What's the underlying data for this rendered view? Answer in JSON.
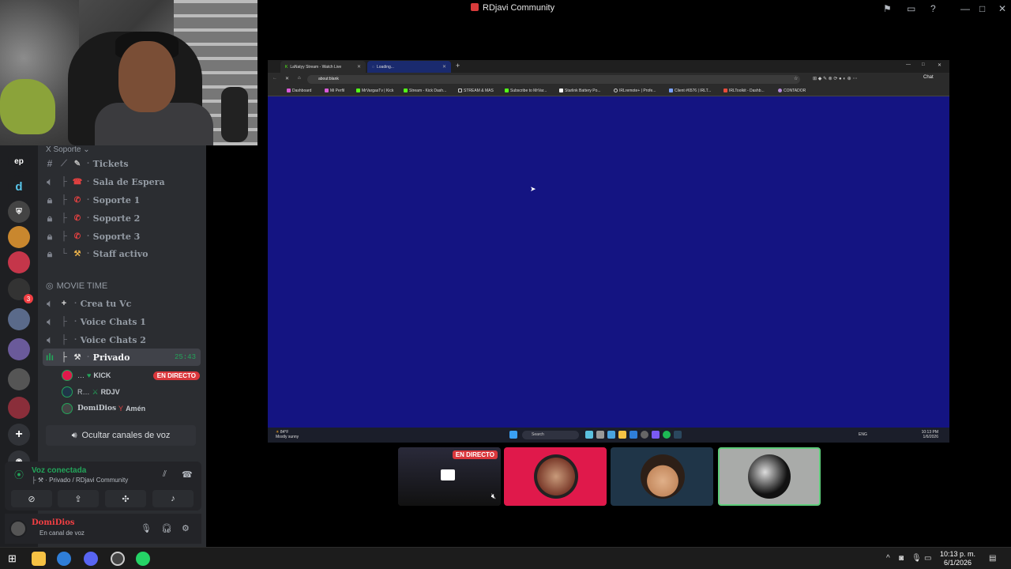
{
  "window": {
    "title": "RDjavi Community"
  },
  "servers": {
    "top_label": "ep",
    "badge1": "3"
  },
  "channels": {
    "support_category": "X Soporte",
    "support_category_chevron": "⌄",
    "support": [
      "Tickets",
      "Sala de Espera",
      "Soporte 1",
      "Soporte 2",
      "Soporte 3",
      "Staff activo"
    ],
    "movie_category": "MOVIE TIME",
    "movie": [
      "Crea tu Vc",
      "Voice Chats 1",
      "Voice Chats 2"
    ],
    "active_channel": "Privado",
    "active_time": "25:43",
    "users": [
      {
        "name": "…",
        "tag": "KICK",
        "live": "EN DIRECTO"
      },
      {
        "name": "R…",
        "tag": "RDJV",
        "live": ""
      },
      {
        "name": "DomiDios",
        "tag": "Amén",
        "live": ""
      }
    ],
    "hide_voice": "Ocultar canales de voz"
  },
  "voice": {
    "status": "Voz conectada",
    "channel": "Privado / RDjavi Community"
  },
  "user": {
    "name": "DomiDios",
    "status": "En canal de voz"
  },
  "browser": {
    "tabs": [
      {
        "label": "LaNatyy Stream - Watch Live"
      },
      {
        "label": "Loading..."
      }
    ],
    "url": "about:blank",
    "chat_label": "Chat",
    "bookmarks": [
      "Dashboard",
      "Mi Perfil",
      "MrVargasTv | Kick",
      "Stream - Kick Dash...",
      "STREAM & MAS",
      "Subscribe to MrVar...",
      "Starlink Battery Po...",
      "IRLremote+ | Profe...",
      "Client #6576 | IRLT...",
      "IRLToolkit - Dashb...",
      "CONTADOR"
    ]
  },
  "inner_taskbar": {
    "weather": "84°F",
    "weather_desc": "Mostly sunny",
    "search": "Search",
    "lang": "ENG",
    "time": "10:13 PM",
    "date": "1/6/2026"
  },
  "tiles": {
    "live_label": "EN DIRECTO"
  },
  "taskbar": {
    "time": "10:13 p. m.",
    "date": "6/1/2026"
  },
  "colors": {
    "page_bg": "#141482",
    "live": "#da373c",
    "online": "#23a55a",
    "tile_pink": "#e0194b"
  }
}
